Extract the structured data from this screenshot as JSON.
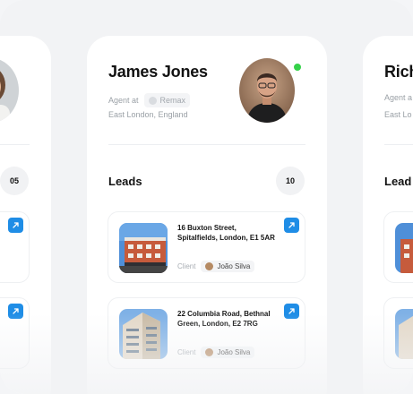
{
  "cards": {
    "left": {
      "leads_count": "05"
    },
    "center": {
      "name": "James Jones",
      "agent_prefix": "Agent at",
      "agency": "Remax",
      "location": "East London, England",
      "leads_title": "Leads",
      "leads_count": "10",
      "leads": [
        {
          "address": "16 Buxton Street, Spitalfields, London, E1 5AR",
          "client_label": "Client",
          "client_name": "João Silva"
        },
        {
          "address": "22 Columbia Road, Bethnal Green, London, E2 7RG",
          "client_label": "Client",
          "client_name": "João Silva"
        }
      ]
    },
    "right": {
      "name": "Rich",
      "agent_prefix": "Agent a",
      "location": "East Lo",
      "leads_title": "Lead"
    }
  },
  "colors": {
    "accent": "#1f8de6",
    "online": "#35d24a",
    "background": "#f2f3f5"
  },
  "icons": {
    "open": "arrow-up-right-icon",
    "agency": "agency-logo-icon"
  }
}
